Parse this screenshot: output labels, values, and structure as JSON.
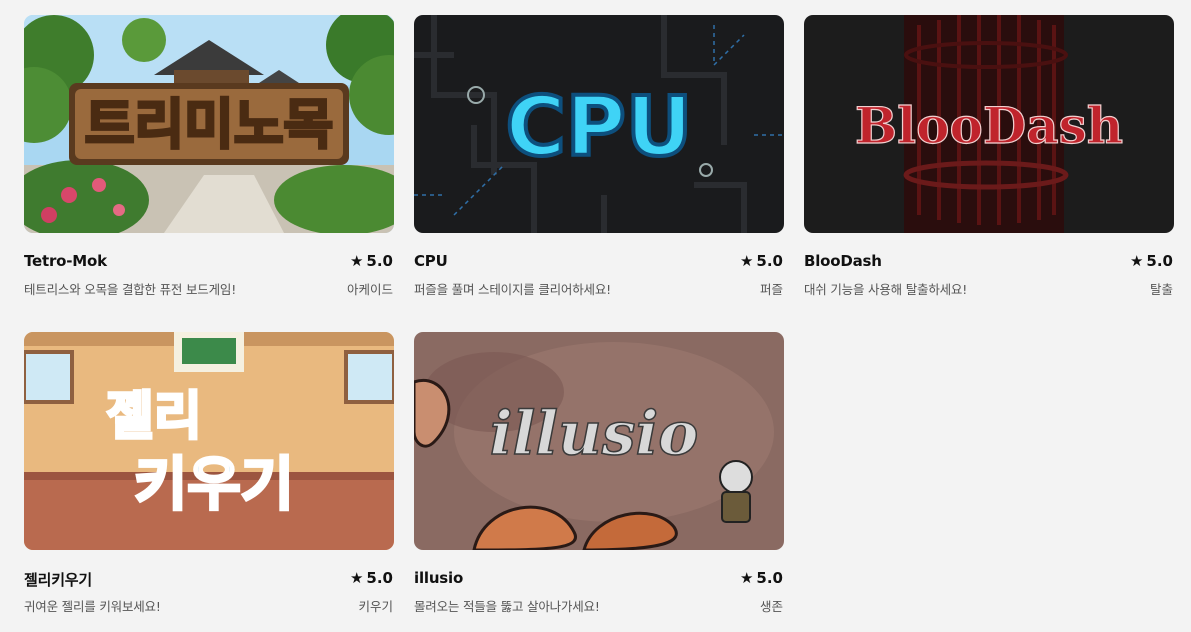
{
  "games": [
    {
      "title": "Tetro-Mok",
      "rating": "5.0",
      "description": "테트리스와 오목을 결합한 퓨전 보드게임!",
      "genre": "아케이드",
      "logo_text": "트리미노목"
    },
    {
      "title": "CPU",
      "rating": "5.0",
      "description": "퍼즐을 풀며 스테이지를 클리어하세요!",
      "genre": "퍼즐",
      "logo_text": "CPU"
    },
    {
      "title": "BlooDash",
      "rating": "5.0",
      "description": "대쉬 기능을 사용해 탈출하세요!",
      "genre": "탈출",
      "logo_text": "BlooDash"
    },
    {
      "title": "젤리키우기",
      "rating": "5.0",
      "description": "귀여운 젤리를 키워보세요!",
      "genre": "키우기",
      "logo_line1": "젤리",
      "logo_line2": "키우기"
    },
    {
      "title": "illusio",
      "rating": "5.0",
      "description": "몰려오는 적들을 뚫고 살아나가세요!",
      "genre": "생존",
      "logo_text": "illusio"
    }
  ],
  "icons": {
    "star": "★"
  },
  "colors": {
    "background": "#f3f3f3",
    "title": "#111111",
    "subtext": "#555555"
  }
}
